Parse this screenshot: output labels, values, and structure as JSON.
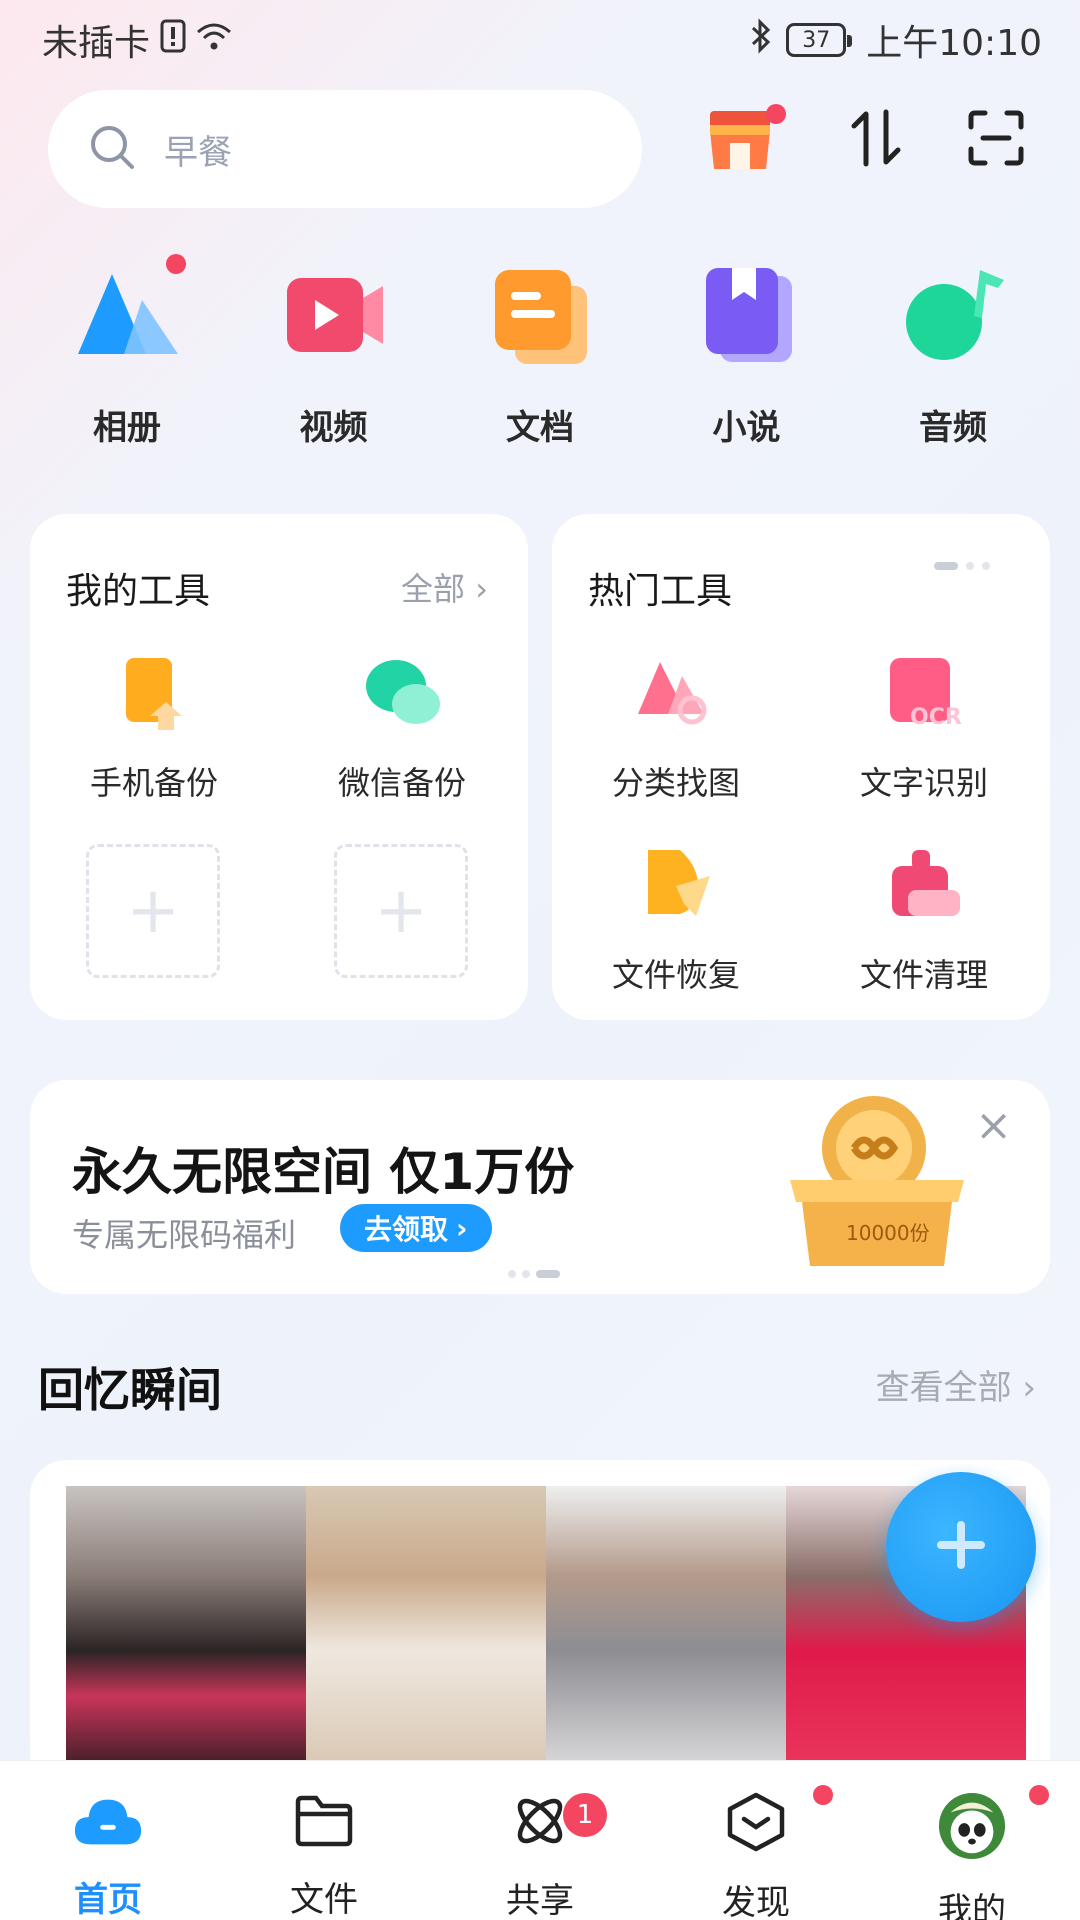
{
  "status_bar": {
    "carrier": "未插卡",
    "battery": "37",
    "time": "上午10:10"
  },
  "search": {
    "placeholder": "早餐"
  },
  "apps": [
    {
      "label": "相册",
      "icon": "album-icon"
    },
    {
      "label": "视频",
      "icon": "video-icon"
    },
    {
      "label": "文档",
      "icon": "document-icon"
    },
    {
      "label": "小说",
      "icon": "novel-icon"
    },
    {
      "label": "音频",
      "icon": "audio-icon"
    }
  ],
  "my_tools": {
    "title": "我的工具",
    "more": "全部",
    "items": [
      {
        "label": "手机备份",
        "icon": "phone-backup-icon"
      },
      {
        "label": "微信备份",
        "icon": "wechat-backup-icon"
      }
    ]
  },
  "hot_tools": {
    "title": "热门工具",
    "items": [
      {
        "label": "分类找图",
        "icon": "find-image-icon"
      },
      {
        "label": "文字识别",
        "icon": "ocr-icon"
      },
      {
        "label": "文件恢复",
        "icon": "file-recovery-icon"
      },
      {
        "label": "文件清理",
        "icon": "file-clean-icon"
      }
    ]
  },
  "promo": {
    "title": "永久无限空间 仅1万份",
    "subtitle": "专属无限码福利",
    "button": "去领取",
    "box_text": "10000份"
  },
  "memories": {
    "title": "回忆瞬间",
    "more": "查看全部"
  },
  "bottom_nav": [
    {
      "label": "首页",
      "icon": "cloud-home-icon",
      "active": true
    },
    {
      "label": "文件",
      "icon": "folder-icon"
    },
    {
      "label": "共享",
      "icon": "share-orbit-icon",
      "badge": "1"
    },
    {
      "label": "发现",
      "icon": "discover-box-icon"
    },
    {
      "label": "我的",
      "icon": "panda-avatar-icon"
    }
  ],
  "colors": {
    "accent": "#1e9bff",
    "dot": "#f44561"
  }
}
